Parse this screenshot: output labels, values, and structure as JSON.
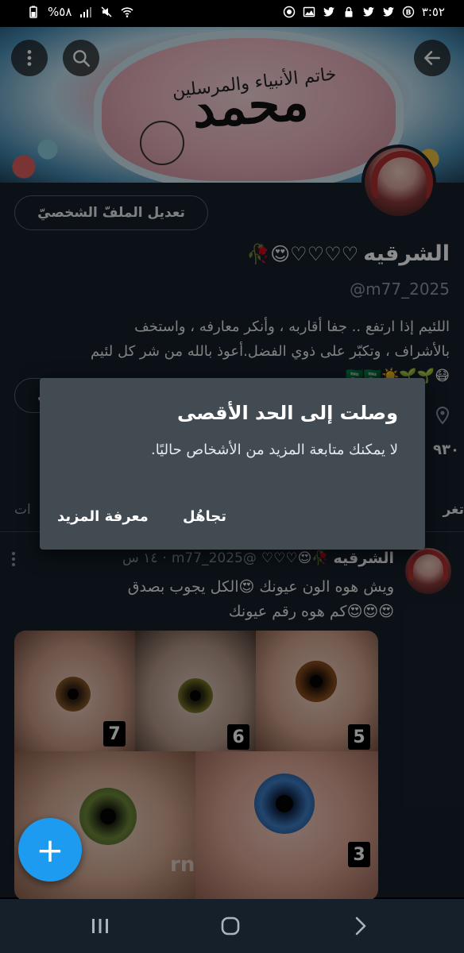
{
  "status_bar": {
    "time": "٣:٥٢",
    "battery": "%٥٨",
    "icons_right": [
      "whatsapp-icon",
      "gallery-icon",
      "twitter-icon",
      "lock-icon",
      "twitter-icon",
      "twitter-icon",
      "b-icon"
    ],
    "icons_left": [
      "battery-icon",
      "signal-icon",
      "mute-icon",
      "wifi-icon"
    ]
  },
  "banner": {
    "calligraphy_main": "محمد",
    "calligraphy_small": "خاتم الأنبياء والمرسلين"
  },
  "profile": {
    "edit_button": "تعديل الملفّ الشخصيّ",
    "display_name": "الشرقيه",
    "name_emojis": "🥀😍♡♡♡♡",
    "handle": "@m77_2025",
    "bio_line1": "اللئيم إذا ارتفع .. جفا أقاربه ، وأنكر معارفه ، واستخف",
    "bio_line2": "بالأشراف ، وتكبّر على ذوي الفضل.أعوذ بالله من شر كل لئيم",
    "bio_line3": "😷🌱🌱☀️🇸🇦🇸🇦",
    "partial_count": "٩٣٠",
    "tab_right": "تغر",
    "tab_left": "ات"
  },
  "dialog": {
    "title": "وصلت إلى الحد الأقصى",
    "message": "لا يمكنك متابعة المزيد من الأشخاص حاليًا.",
    "ignore_label": "تجاهُل",
    "learn_more_label": "معرفة المزيد"
  },
  "tweet": {
    "name": "الشرقيه",
    "name_emojis": "🥀😍♡♡♡",
    "handle": "@m77_2025",
    "time": "١٤ س",
    "separator": "·",
    "text_line1": "ويش هوه الون عيونك 😍الكل يجوب بصدق",
    "text_line2": "😍😍😍كم هوه رقم عيونك",
    "media_numbers": [
      "7",
      "6",
      "5",
      "3"
    ],
    "watermark": "rnf0"
  },
  "fab": {
    "icon": "plus-icon",
    "label": "+"
  },
  "colors": {
    "background": "#15202b",
    "accent": "#1d9bf0",
    "dialog": "#424a52",
    "secondary_text": "#8b98a5"
  }
}
